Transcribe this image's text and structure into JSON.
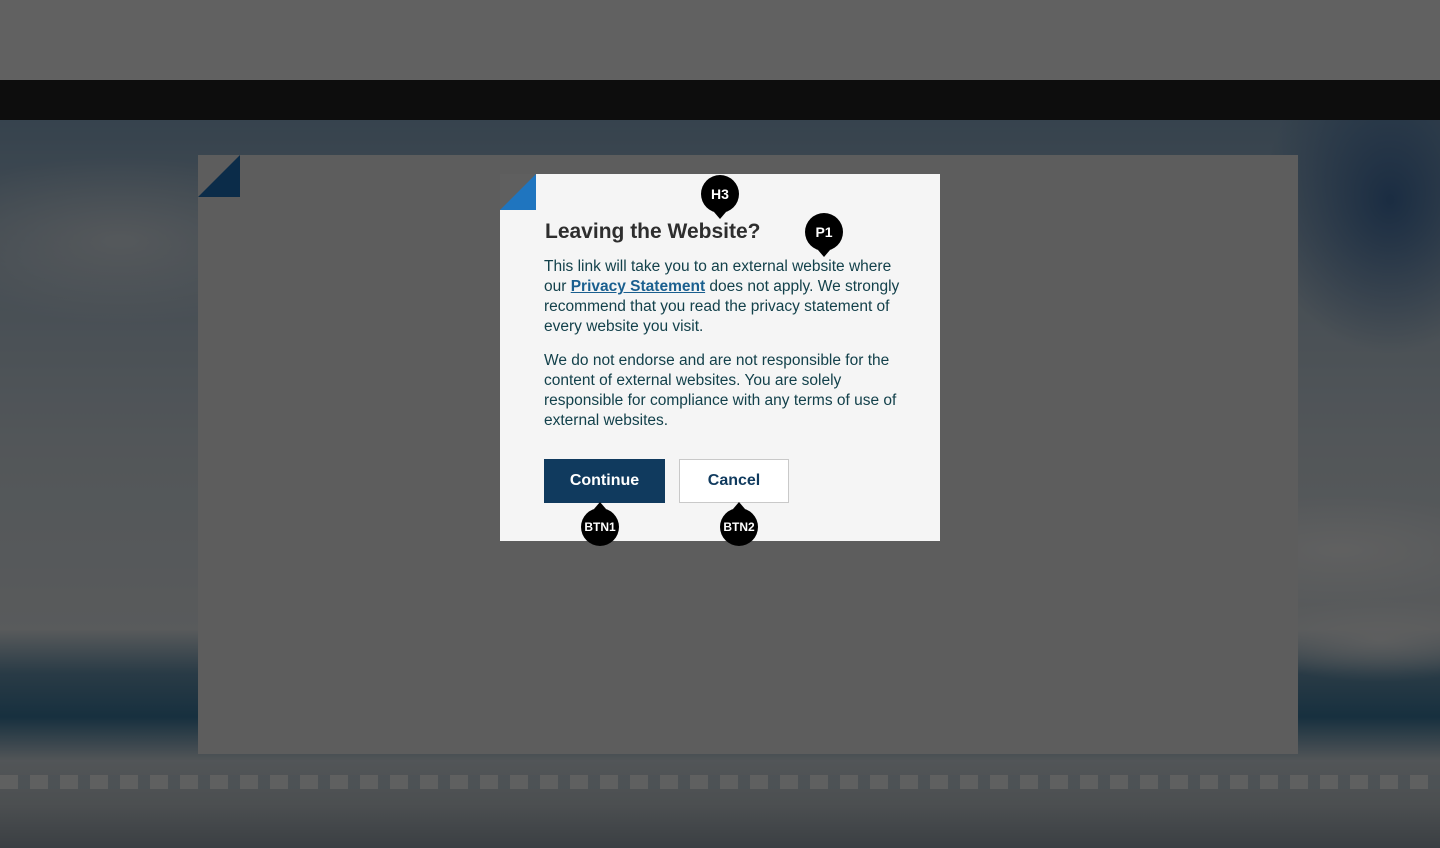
{
  "dialog": {
    "title": "Leaving the Website?",
    "paragraph1_before_link": "This link will take you to an external website where our ",
    "privacy_link_text": "Privacy Statement",
    "paragraph1_after_link": " does not apply.  We strongly recommend that you read the privacy statement of every website you visit.",
    "paragraph2": "We do not endorse and are not responsible for the content of external websites.  You are solely responsible for compliance with any terms of use of external websites.",
    "continue_label": "Continue",
    "cancel_label": "Cancel"
  },
  "markers": {
    "heading": "H3",
    "paragraph": "P1",
    "button1": "BTN1",
    "button2": "BTN2"
  },
  "colors": {
    "accent_blue": "#1f75bf",
    "primary_button": "#103a5e",
    "body_text": "#13414b",
    "link": "#1a5f8f"
  }
}
